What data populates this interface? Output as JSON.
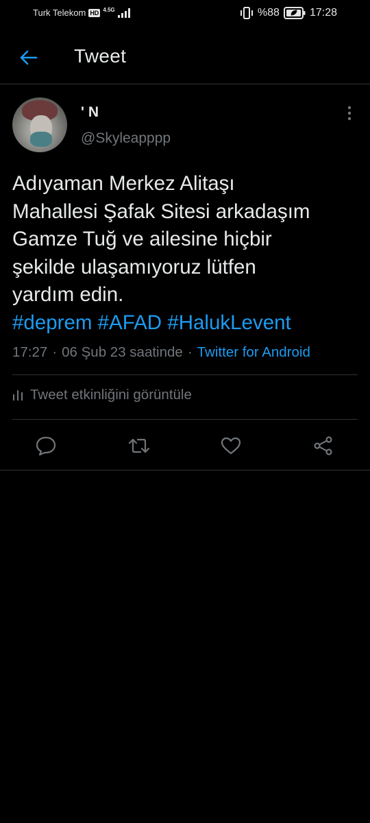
{
  "status_bar": {
    "carrier": "Turk Telekom",
    "hd_badge": "HD",
    "network": "4.5G",
    "battery_percent": "%88",
    "time": "17:28"
  },
  "header": {
    "title": "Tweet",
    "back_icon": "arrow-left-icon"
  },
  "tweet": {
    "display_name": "' N",
    "handle": "@Skyleapppp",
    "text_lines": [
      "Adıyaman Merkez Alitaşı",
      "Mahallesi Şafak Sitesi arkadaşım",
      "Gamze Tuğ ve ailesine hiçbir",
      "şekilde ulaşamıyoruz lütfen",
      "yardım edin."
    ],
    "hashtags": [
      "#deprem",
      "#AFAD",
      "#HalukLevent"
    ],
    "time": "17:27",
    "date": "06 Şub 23 saatinde",
    "separator": "·",
    "source": "Twitter for Android",
    "activity_label": "Tweet etkinliğini görüntüle"
  },
  "actions": [
    {
      "name": "reply",
      "icon": "comment-icon"
    },
    {
      "name": "retweet",
      "icon": "retweet-icon"
    },
    {
      "name": "like",
      "icon": "heart-icon"
    },
    {
      "name": "share",
      "icon": "share-icon"
    }
  ],
  "colors": {
    "background": "#000000",
    "accent": "#1d9bf0",
    "text_primary": "#e7e9ea",
    "text_secondary": "#71767b",
    "divider": "#2f3336"
  }
}
